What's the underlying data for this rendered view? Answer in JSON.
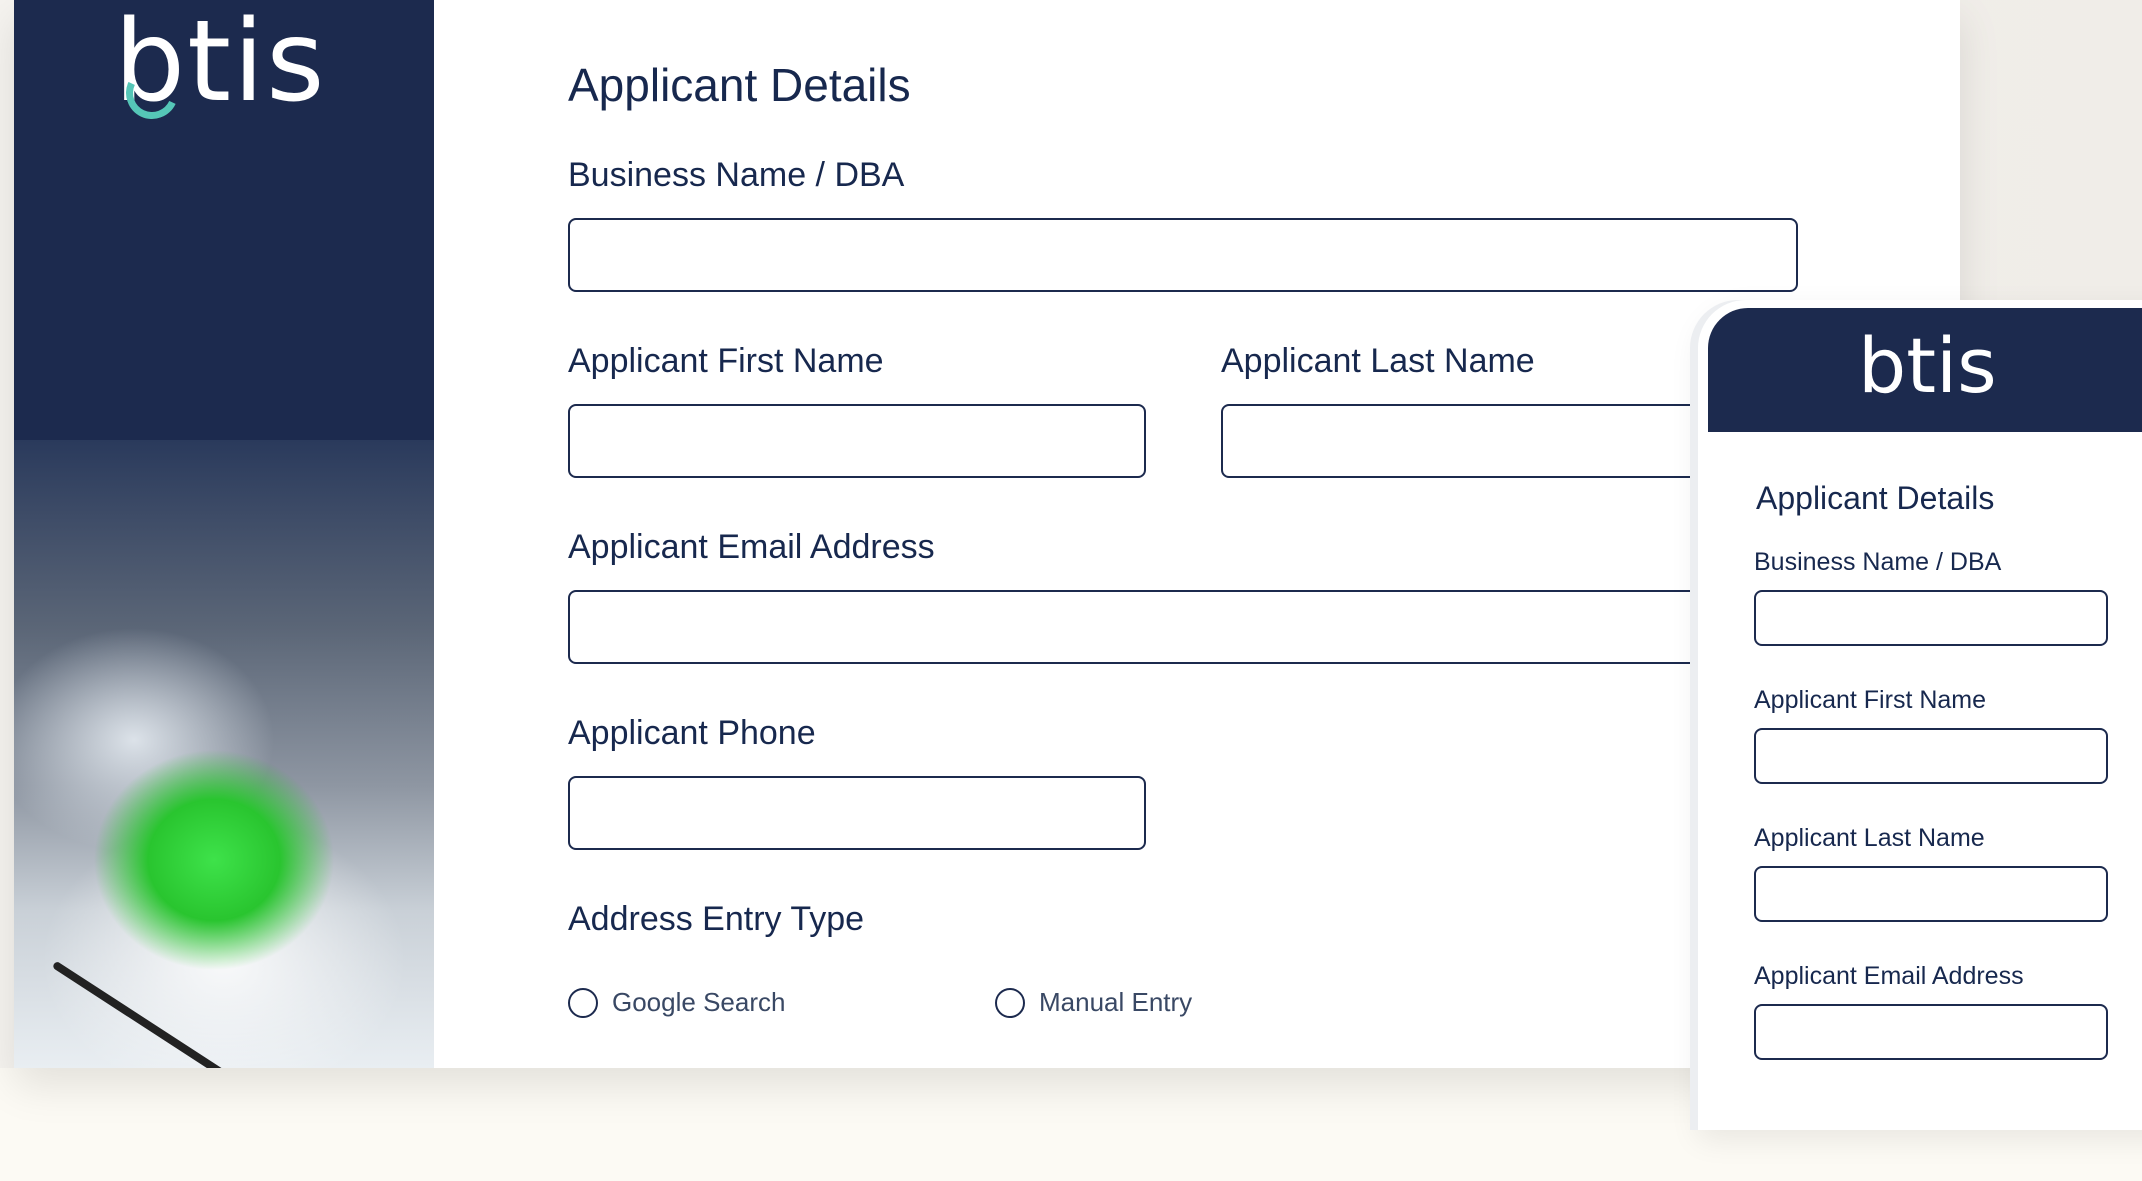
{
  "brand": {
    "logo_text": "btis"
  },
  "desktop_form": {
    "title": "Applicant Details",
    "fields": {
      "business_name": {
        "label": "Business Name / DBA",
        "value": ""
      },
      "first_name": {
        "label": "Applicant First Name",
        "value": ""
      },
      "last_name": {
        "label": "Applicant Last Name",
        "value": ""
      },
      "email": {
        "label": "Applicant Email Address",
        "value": ""
      },
      "phone": {
        "label": "Applicant Phone",
        "value": ""
      }
    },
    "address_entry": {
      "label": "Address Entry Type",
      "options": [
        "Google Search",
        "Manual Entry"
      ]
    }
  },
  "mobile_form": {
    "title": "Applicant Details",
    "fields": {
      "business_name": {
        "label": "Business Name / DBA"
      },
      "first_name": {
        "label": "Applicant First Name"
      },
      "last_name": {
        "label": "Applicant Last Name"
      },
      "email": {
        "label": "Applicant Email Address"
      }
    }
  },
  "colors": {
    "navy": "#1c2a4e",
    "accent": "#55c6b7",
    "background": "#f3f1ec"
  }
}
